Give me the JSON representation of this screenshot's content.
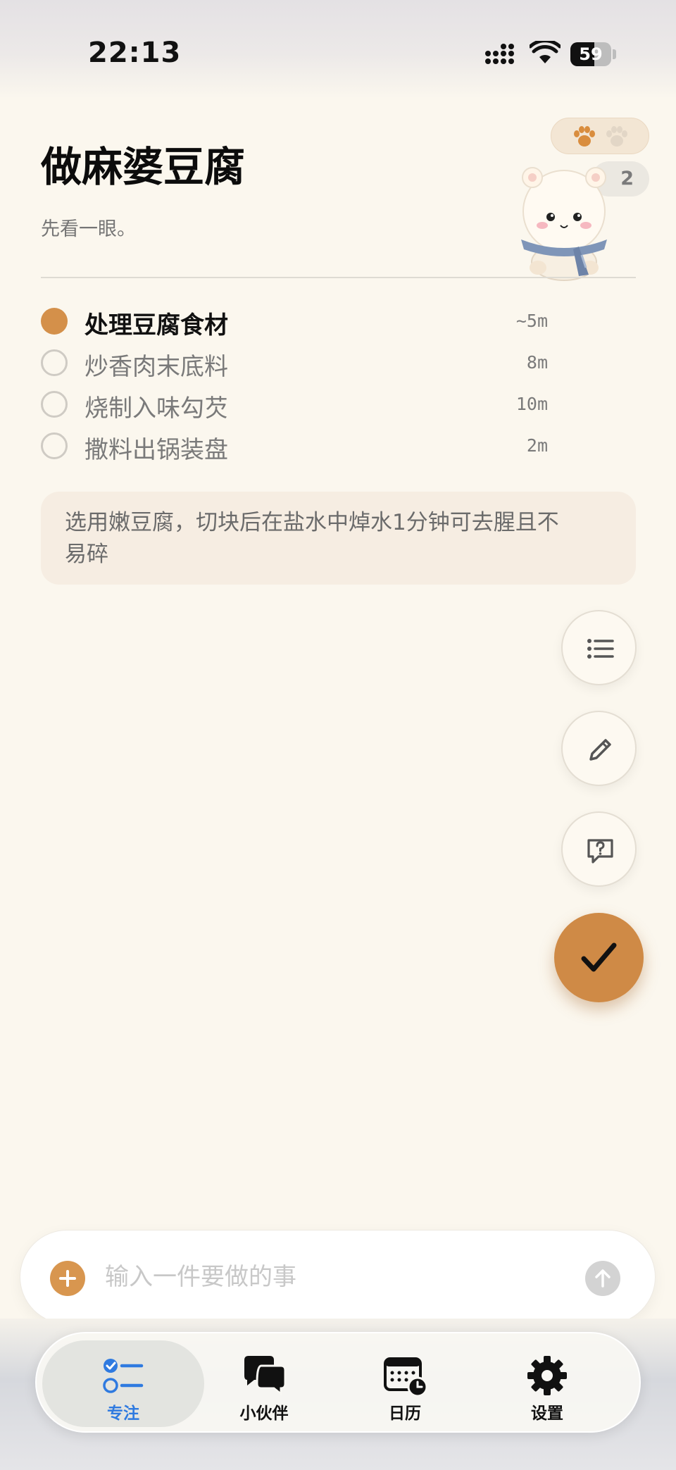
{
  "status_bar": {
    "time": "22:13",
    "battery": "59"
  },
  "header": {
    "title": "做麻婆豆腐",
    "subtitle": "先看一眼。",
    "count": "2"
  },
  "steps": [
    {
      "label": "处理豆腐食材",
      "time": "~5m",
      "active": true
    },
    {
      "label": "炒香肉末底料",
      "time": "8m",
      "active": false
    },
    {
      "label": "烧制入味勾芡",
      "time": "10m",
      "active": false
    },
    {
      "label": "撒料出锅装盘",
      "time": "2m",
      "active": false
    }
  ],
  "tip": {
    "text": "选用嫩豆腐，切块后在盐水中焯水1分钟可去腥且不易碎"
  },
  "input": {
    "placeholder": "输入一件要做的事",
    "value": ""
  },
  "tabs": [
    {
      "label": "专注",
      "selected": true
    },
    {
      "label": "小伙伴",
      "selected": false
    },
    {
      "label": "日历",
      "selected": false
    },
    {
      "label": "设置",
      "selected": false
    }
  ],
  "colors": {
    "accent": "#cf8a46",
    "tab_selected": "#2f7ae0",
    "background": "#fbf7ee"
  },
  "icons": {
    "fabs": [
      "list-icon",
      "pencil-icon",
      "help-bubble-icon",
      "checkmark-icon"
    ],
    "tabs": [
      "focus-list-icon",
      "chat-bubbles-icon",
      "calendar-clock-icon",
      "gear-icon"
    ],
    "header": [
      "paw-icon",
      "paw-icon",
      "hamster-mascot"
    ]
  }
}
